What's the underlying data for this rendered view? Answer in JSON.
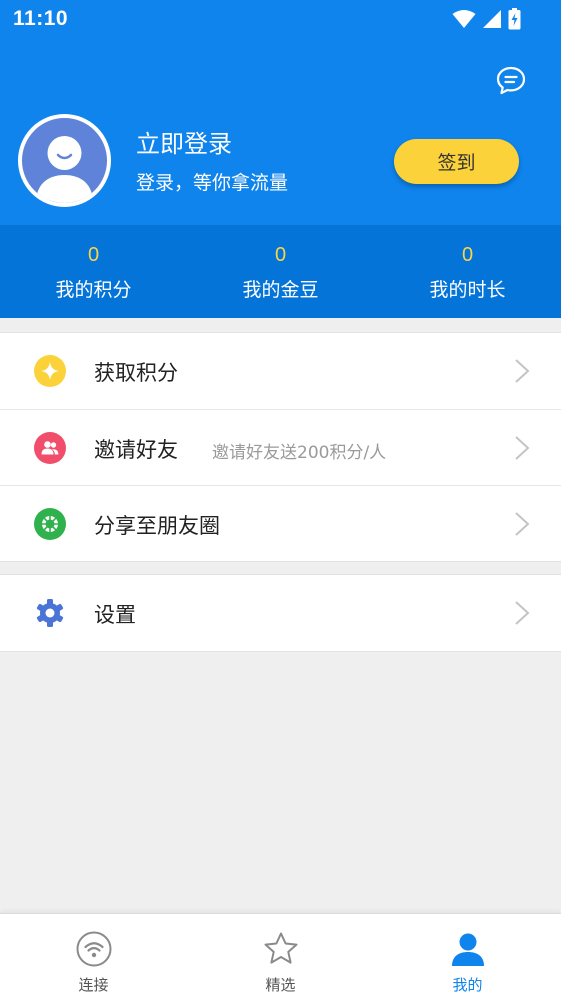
{
  "status_bar": {
    "time": "11:10"
  },
  "header": {
    "login_title": "立即登录",
    "login_subtitle": "登录，等你拿流量",
    "checkin_label": "签到"
  },
  "stats": [
    {
      "value": "0",
      "label": "我的积分"
    },
    {
      "value": "0",
      "label": "我的金豆"
    },
    {
      "value": "0",
      "label": "我的时长"
    }
  ],
  "menu": {
    "get_points": {
      "label": "获取积分",
      "icon": "star-icon",
      "color": "#fcd23a"
    },
    "invite": {
      "label": "邀请好友",
      "desc": "邀请好友送200积分/人",
      "icon": "users-icon",
      "color": "#f04e6a"
    },
    "share": {
      "label": "分享至朋友圈",
      "icon": "moments-icon",
      "color": "#2fb24c"
    },
    "settings": {
      "label": "设置",
      "icon": "gear-icon",
      "color": "#4a74d6"
    }
  },
  "tabs": [
    {
      "label": "连接",
      "icon": "wifi-icon"
    },
    {
      "label": "精选",
      "icon": "star-outline-icon"
    },
    {
      "label": "我的",
      "icon": "person-icon",
      "active": true
    }
  ],
  "colors": {
    "header_blue": "#0f84ec",
    "stats_blue": "#0574d9",
    "stat_value": "#f8d44a",
    "checkin_yellow": "#fcd23a",
    "active_tab": "#0f84ec"
  }
}
